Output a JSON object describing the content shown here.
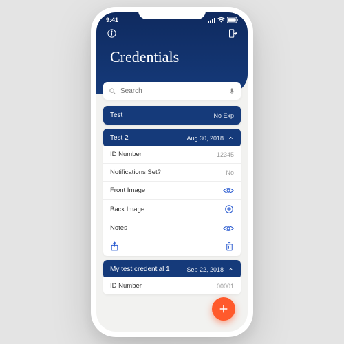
{
  "status": {
    "time": "9:41",
    "signal": "•••",
    "wifi": "⧋",
    "battery": "▮"
  },
  "app": {
    "title": "Credentials"
  },
  "search": {
    "placeholder": "Search"
  },
  "cards": [
    {
      "title": "Test",
      "meta": "No Exp"
    },
    {
      "title": "Test 2",
      "meta": "Aug 30, 2018"
    },
    {
      "title": "My test credential 1",
      "meta": "Sep 22, 2018"
    }
  ],
  "detail": {
    "rows": [
      {
        "label": "ID Number",
        "value": "12345"
      },
      {
        "label": "Notifications Set?",
        "value": "No"
      },
      {
        "label": "Front Image",
        "value": ""
      },
      {
        "label": "Back Image",
        "value": ""
      },
      {
        "label": "Notes",
        "value": ""
      }
    ]
  },
  "detail2": {
    "row0_label": "ID Number",
    "row0_value": "00001"
  },
  "colors": {
    "brand": "#153a7a",
    "fab": "#ff5a2c",
    "accent": "#2a5bd0"
  }
}
